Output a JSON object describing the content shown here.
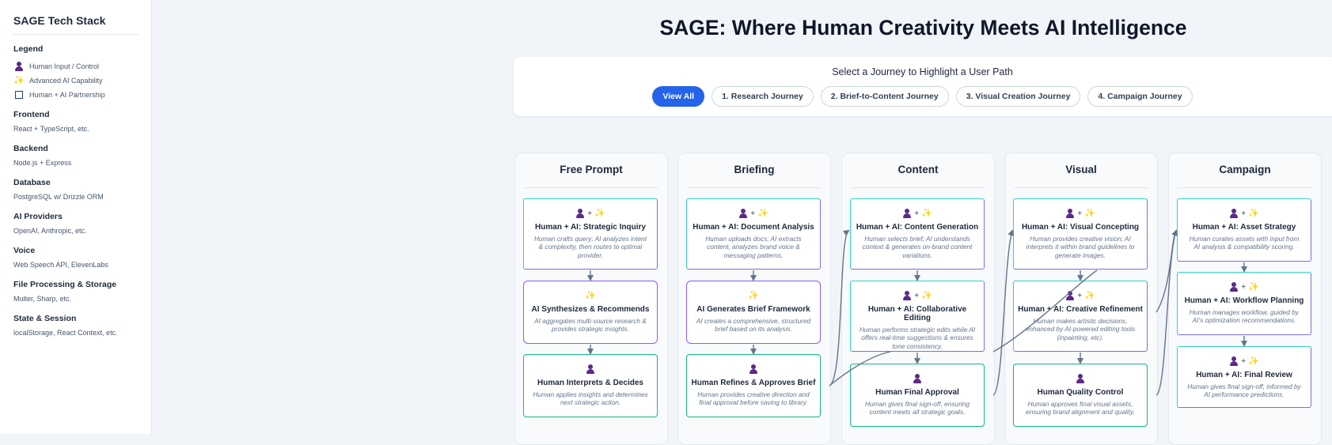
{
  "sidebar": {
    "title": "SAGE Tech Stack",
    "legend": {
      "heading": "Legend",
      "items": [
        {
          "icon": "human-icon",
          "label": "Human Input / Control"
        },
        {
          "icon": "sparkle-icon",
          "label": "Advanced AI Capability"
        },
        {
          "icon": "partnership-box-icon",
          "label": "Human + AI Partnership"
        }
      ]
    },
    "sections": [
      {
        "heading": "Frontend",
        "value": "React + TypeScript, etc."
      },
      {
        "heading": "Backend",
        "value": "Node.js + Express"
      },
      {
        "heading": "Database",
        "value": "PostgreSQL w/ Drizzle ORM"
      },
      {
        "heading": "AI Providers",
        "value": "OpenAI, Anthropic, etc."
      },
      {
        "heading": "Voice",
        "value": "Web Speech API, ElevenLabs"
      },
      {
        "heading": "File Processing & Storage",
        "value": "Multer, Sharp, etc."
      },
      {
        "heading": "State & Session",
        "value": "localStorage, React Context, etc."
      }
    ]
  },
  "main": {
    "title": "SAGE: Where Human Creativity Meets AI Intelligence",
    "journey": {
      "label": "Select a Journey to Highlight a User Path",
      "buttons": [
        "View All",
        "1. Research Journey",
        "2. Brief-to-Content Journey",
        "3. Visual Creation Journey",
        "4. Campaign Journey"
      ],
      "active": "View All"
    },
    "colors": {
      "accent": "#2563eb",
      "human": "#5b2a86",
      "ai": "#f59e0b",
      "human_border": "#10b981",
      "ai_border": "#8b5cf6",
      "connector": "#64748b"
    },
    "columns": [
      {
        "title": "Free Prompt",
        "cards": [
          {
            "type": "partner",
            "title": "Human + AI: Strategic Inquiry",
            "desc": "Human crafts query; AI analyzes intent & complexity, then routes to optimal provider."
          },
          {
            "type": "ai",
            "title": "AI Synthesizes & Recommends",
            "desc": "AI aggregates multi-source research & provides strategic insights."
          },
          {
            "type": "human",
            "title": "Human Interprets & Decides",
            "desc": "Human applies insights and determines next strategic action."
          }
        ]
      },
      {
        "title": "Briefing",
        "cards": [
          {
            "type": "partner",
            "title": "Human + AI: Document Analysis",
            "desc": "Human uploads docs; AI extracts content, analyzes brand voice & messaging patterns."
          },
          {
            "type": "ai",
            "title": "AI Generates Brief Framework",
            "desc": "AI creates a comprehensive, structured brief based on its analysis."
          },
          {
            "type": "human",
            "title": "Human Refines & Approves Brief",
            "desc": "Human provides creative direction and final approval before saving to library."
          }
        ]
      },
      {
        "title": "Content",
        "cards": [
          {
            "type": "partner",
            "title": "Human + AI: Content Generation",
            "desc": "Human selects brief; AI understands context & generates on-brand content variations."
          },
          {
            "type": "partner",
            "title": "Human + AI: Collaborative Editing",
            "desc": "Human performs strategic edits while AI offers real-time suggestions & ensures tone consistency."
          },
          {
            "type": "human",
            "title": "Human Final Approval",
            "desc": "Human gives final sign-off, ensuring content meets all strategic goals."
          }
        ]
      },
      {
        "title": "Visual",
        "cards": [
          {
            "type": "partner",
            "title": "Human + AI: Visual Concepting",
            "desc": "Human provides creative vision; AI interprets it within brand guidelines to generate images."
          },
          {
            "type": "partner",
            "title": "Human + AI: Creative Refinement",
            "desc": "Human makes artistic decisions, enhanced by AI-powered editing tools (inpainting, etc)."
          },
          {
            "type": "human",
            "title": "Human Quality Control",
            "desc": "Human approves final visual assets, ensuring brand alignment and quality."
          }
        ]
      },
      {
        "title": "Campaign",
        "cards": [
          {
            "type": "partner",
            "title": "Human + AI: Asset Strategy",
            "desc": "Human curates assets with input from AI analysis & compatibility scoring."
          },
          {
            "type": "partner",
            "title": "Human + AI: Workflow Planning",
            "desc": "Human manages workflow, guided by AI's optimization recommendations."
          },
          {
            "type": "partner",
            "title": "Human + AI: Final Review",
            "desc": "Human gives final sign-off, informed by AI performance predictions."
          }
        ]
      }
    ]
  }
}
